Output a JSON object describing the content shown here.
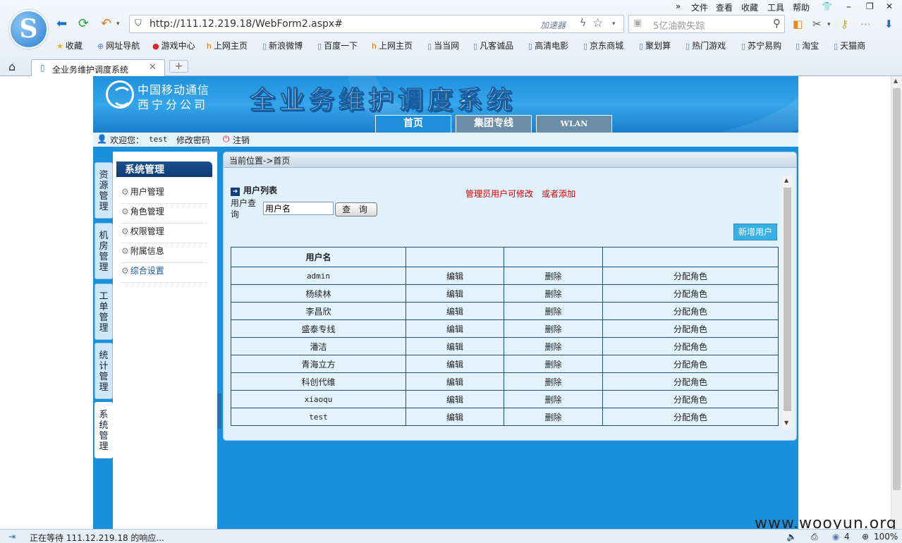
{
  "browser": {
    "menu": [
      "»",
      "文件",
      "查看",
      "收藏",
      "工具",
      "帮助"
    ],
    "url": "http://111.12.219.18/WebForm2.aspx#",
    "accelerator": "加速器",
    "search_placeholder": "5亿油款失踪",
    "bookmarks": [
      "收藏",
      "网址导航",
      "游戏中心",
      "上网主页",
      "新浪微博",
      "百度一下",
      "上网主页",
      "当当网",
      "凡客诚品",
      "高清电影",
      "京东商城",
      "聚划算",
      "热门游戏",
      "苏宁易购",
      "淘宝",
      "天猫商"
    ],
    "tab_title": "全业务维护调度系统",
    "new_tab": "+",
    "status_text": "正在等待 111.12.219.18 的响应...",
    "status_count": "4",
    "zoom": "100%"
  },
  "app": {
    "company_line1": "中国移动通信",
    "company_line2": "西宁分公司",
    "system_title": "全业务维护调度系统",
    "nav_tabs": [
      "首页",
      "集团专线",
      "WLAN"
    ],
    "welcome": "欢迎您：",
    "username": "test",
    "change_password": "修改密码",
    "logout": "注销",
    "vtabs": [
      "资源管理",
      "机房管理",
      "工单管理",
      "统计管理",
      "系统管理"
    ],
    "side_title": "系统管理",
    "side_items": [
      "用户管理",
      "角色管理",
      "权限管理",
      "附属信息",
      "综合设置"
    ],
    "breadcrumb": "当前位置->首页",
    "list_title": "用户列表",
    "notice": "管理员用户可修改　或者添加",
    "query_label": "用户查询",
    "query_value": "用户名",
    "query_button": "查 询",
    "add_button": "新增用户",
    "table_header": [
      "用户名",
      "",
      "",
      ""
    ],
    "rows": [
      [
        "admin",
        "编辑",
        "删除",
        "分配角色"
      ],
      [
        "杨续林",
        "编辑",
        "删除",
        "分配角色"
      ],
      [
        "李昌欣",
        "编辑",
        "删除",
        "分配角色"
      ],
      [
        "盛泰专线",
        "编辑",
        "删除",
        "分配角色"
      ],
      [
        "潘洁",
        "编辑",
        "删除",
        "分配角色"
      ],
      [
        "青海立方",
        "编辑",
        "删除",
        "分配角色"
      ],
      [
        "科创代维",
        "编辑",
        "删除",
        "分配角色"
      ],
      [
        "xiaoqu",
        "编辑",
        "删除",
        "分配角色"
      ],
      [
        "test",
        "编辑",
        "删除",
        "分配角色"
      ]
    ]
  },
  "watermark": "www.wooyun.org"
}
